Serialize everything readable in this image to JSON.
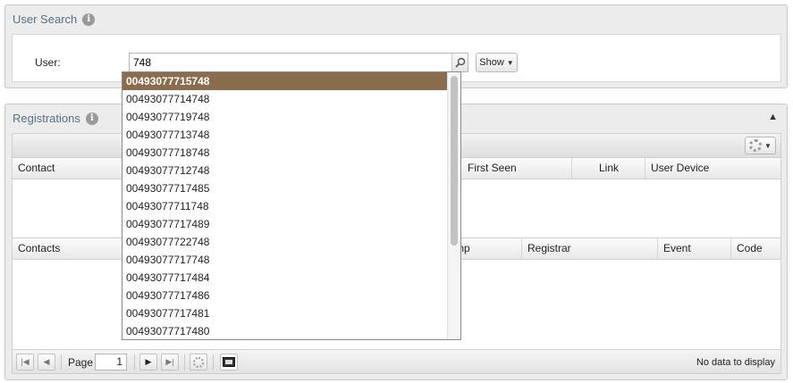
{
  "user_search": {
    "title": "User Search",
    "user_label": "User:",
    "query": "748",
    "show_label": "Show"
  },
  "registrations": {
    "title": "Registrations",
    "columns_top": [
      "Contact",
      "First Seen",
      "Link",
      "User Device"
    ],
    "columns_bottom": [
      "Contacts",
      "mp",
      "Registrar",
      "Event",
      "Code"
    ],
    "pager": {
      "page_label": "Page",
      "page_value": "1",
      "empty_text": "No data to display"
    }
  },
  "suggestions": [
    "00493077715748",
    "00493077714748",
    "00493077719748",
    "00493077713748",
    "00493077718748",
    "00493077712748",
    "00493077717485",
    "00493077711748",
    "00493077717489",
    "00493077722748",
    "00493077717748",
    "00493077717484",
    "00493077717486",
    "00493077717481",
    "00493077717480"
  ],
  "colors": {
    "selected_row": "#8a6c4e",
    "title_text": "#5a6f86"
  }
}
